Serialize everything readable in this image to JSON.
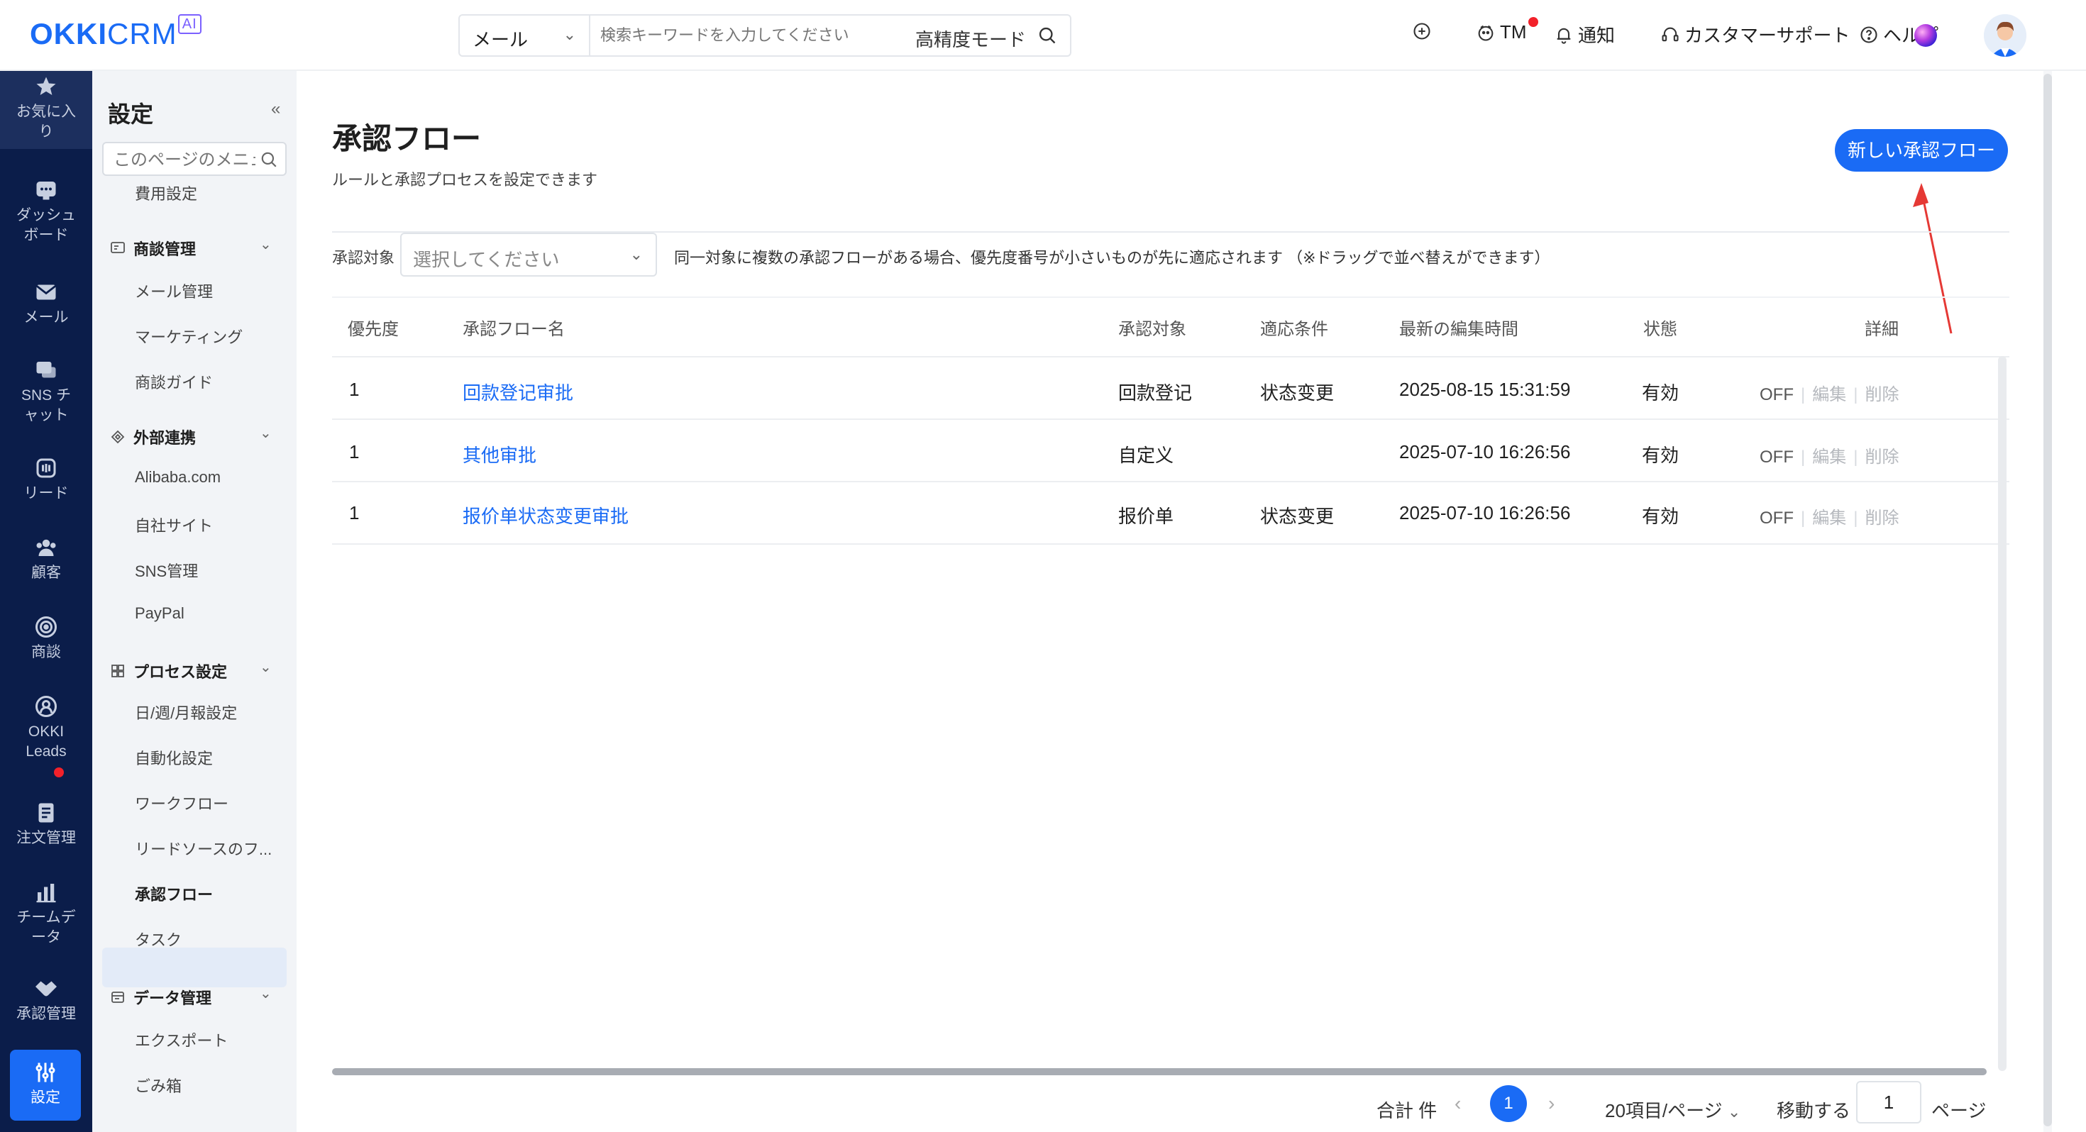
{
  "header": {
    "logo_main": "OKKI",
    "logo_crm": "CRM",
    "logo_ai": "AI",
    "search_type": "メール",
    "search_placeholder": "検索キーワードを入力してください",
    "precision_mode": "高精度モード",
    "tm_label": "TM",
    "notify_label": "通知",
    "support_label": "カスタマーサポート",
    "help_label": "ヘルプ"
  },
  "leftnav": {
    "items": [
      {
        "label": "お気に入り",
        "icon": "star-icon"
      },
      {
        "label": "ダッシュボード",
        "icon": "dashboard-icon"
      },
      {
        "label": "メール",
        "icon": "mail-icon"
      },
      {
        "label": "SNS チャット",
        "icon": "chat-icon"
      },
      {
        "label": "リード",
        "icon": "lead-icon"
      },
      {
        "label": "顧客",
        "icon": "customers-icon"
      },
      {
        "label": "商談",
        "icon": "target-icon"
      },
      {
        "label": "OKKI Leads",
        "icon": "okki-leads-icon"
      },
      {
        "label": "注文管理",
        "icon": "order-icon"
      },
      {
        "label": "チームデータ",
        "icon": "chart-icon"
      },
      {
        "label": "承認管理",
        "icon": "handshake-icon"
      },
      {
        "label": "設定",
        "icon": "settings-sliders-icon"
      }
    ]
  },
  "sidebar": {
    "title": "設定",
    "search_placeholder": "このページのメニュー",
    "cost": "費用設定",
    "group_deal": "商談管理",
    "deal_items": [
      "メール管理",
      "マーケティング",
      "商談ガイド"
    ],
    "group_external": "外部連携",
    "external_items": [
      "Alibaba.com",
      "自社サイト",
      "SNS管理",
      "PayPal"
    ],
    "group_process": "プロセス設定",
    "process_items": [
      "日/週/月報設定",
      "自動化設定",
      "ワークフロー",
      "リードソースのフ...",
      "承認フロー",
      "タスク"
    ],
    "group_data": "データ管理",
    "data_items": [
      "エクスポート",
      "ごみ箱"
    ]
  },
  "main": {
    "title": "承認フロー",
    "subtitle": "ルールと承認プロセスを設定できます",
    "new_button": "新しい承認フロー",
    "filter_label": "承認対象",
    "filter_placeholder": "選択してください",
    "filter_note": "同一対象に複数の承認フローがある場合、優先度番号が小さいものが先に適応されます （※ドラッグで並べ替えができます）",
    "columns": [
      "優先度",
      "承認フロー名",
      "承認対象",
      "適応条件",
      "最新の編集時間",
      "状態",
      "詳細"
    ],
    "rows": [
      {
        "priority": "1",
        "name": "回款登记审批",
        "target": "回款登记",
        "condition": "状态变更",
        "edited": "2025-08-15 15:31:59",
        "status": "有効",
        "off": "OFF",
        "edit": "編集",
        "delete": "削除"
      },
      {
        "priority": "1",
        "name": "其他审批",
        "target": "自定义",
        "condition": "",
        "edited": "2025-07-10 16:26:56",
        "status": "有効",
        "off": "OFF",
        "edit": "編集",
        "delete": "削除"
      },
      {
        "priority": "1",
        "name": "报价单状态变更审批",
        "target": "报价单",
        "condition": "状态变更",
        "edited": "2025-07-10 16:26:56",
        "status": "有効",
        "off": "OFF",
        "edit": "編集",
        "delete": "削除"
      }
    ]
  },
  "pagination": {
    "total": "合計 件",
    "current": "1",
    "per_page": "20項目/ページ",
    "goto_label": "移動する",
    "goto_value": "1",
    "page_suffix": "ページ"
  },
  "colors": {
    "primary": "#1a6bf5",
    "nav_bg": "#0b1d4a",
    "badge_red": "#f2212a",
    "arrow_red": "#e53935"
  }
}
